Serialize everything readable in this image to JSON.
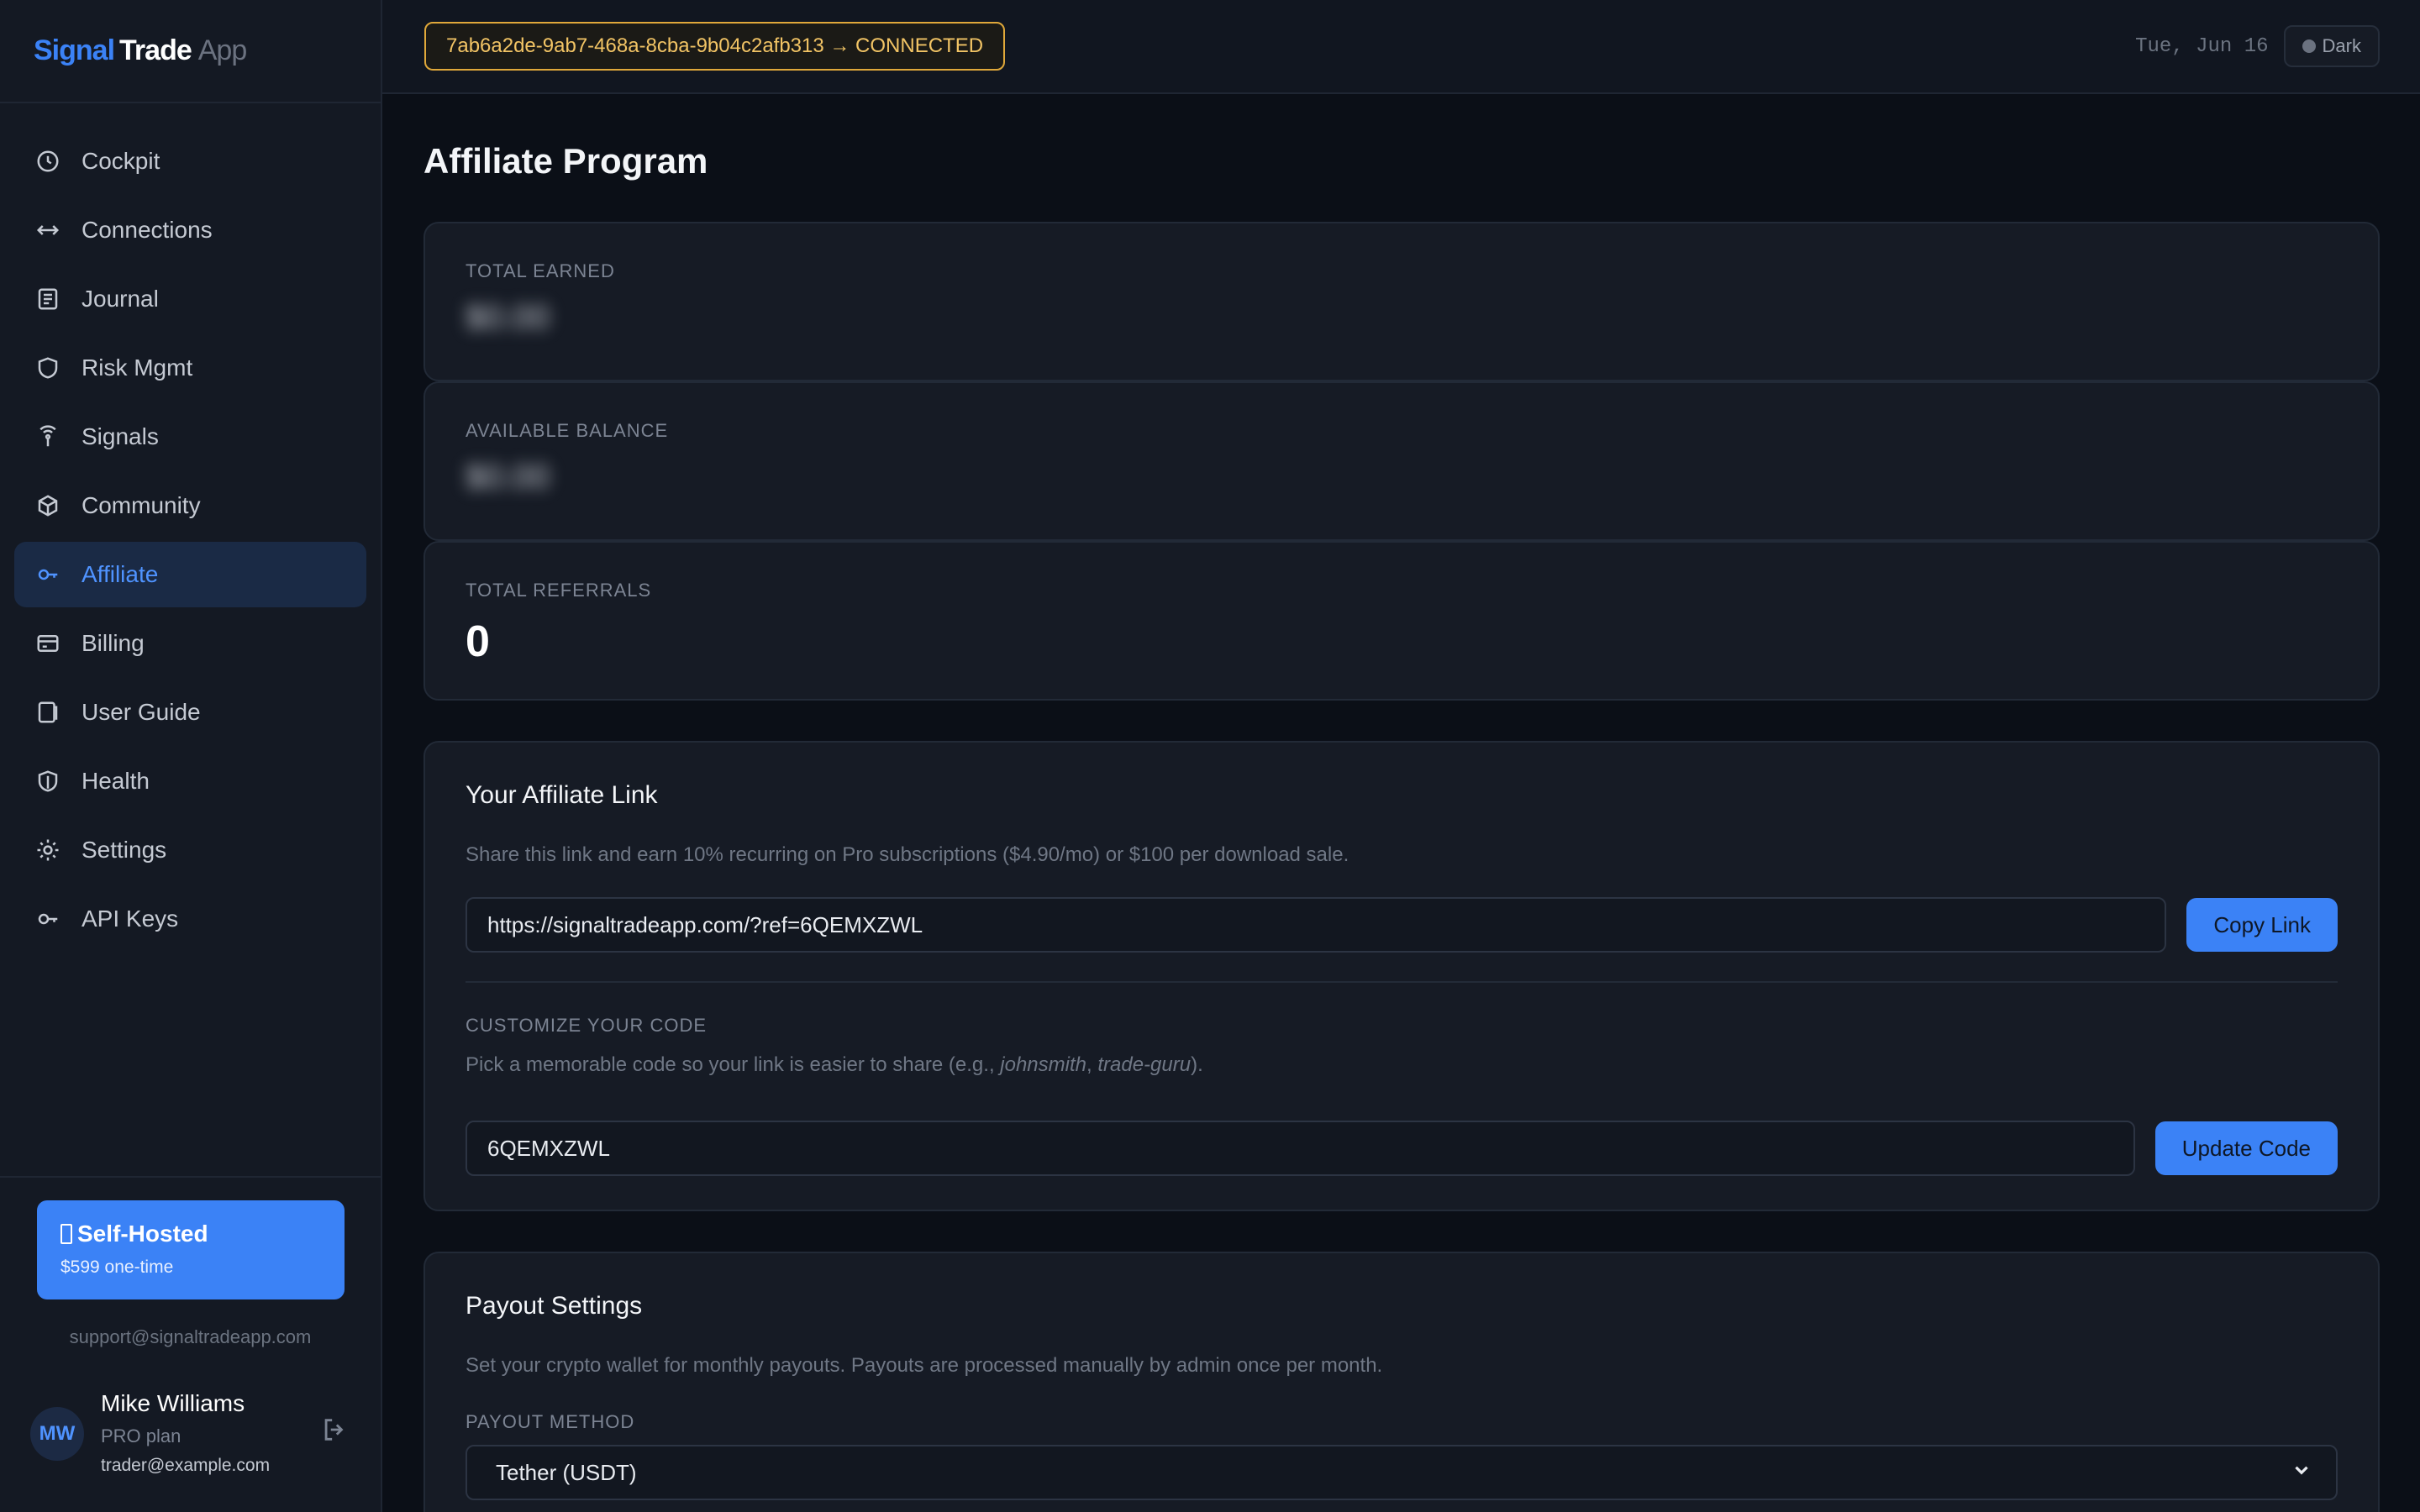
{
  "brand": {
    "part1": "Signal",
    "part2": "Trade",
    "part3": "App"
  },
  "nav": {
    "items": [
      {
        "label": "Cockpit",
        "icon": "clock-icon"
      },
      {
        "label": "Connections",
        "icon": "arrows-horizontal-icon"
      },
      {
        "label": "Journal",
        "icon": "journal-icon"
      },
      {
        "label": "Risk Mgmt",
        "icon": "shield-icon"
      },
      {
        "label": "Signals",
        "icon": "broadcast-icon"
      },
      {
        "label": "Community",
        "icon": "cube-icon"
      },
      {
        "label": "Affiliate",
        "icon": "key-icon"
      },
      {
        "label": "Billing",
        "icon": "credit-card-icon"
      },
      {
        "label": "User Guide",
        "icon": "book-icon"
      },
      {
        "label": "Health",
        "icon": "heart-shield-icon"
      },
      {
        "label": "Settings",
        "icon": "gear-icon"
      },
      {
        "label": "API Keys",
        "icon": "key-icon"
      }
    ],
    "active": "Affiliate"
  },
  "promo": {
    "title": "Self-Hosted",
    "price": "$599 one-time"
  },
  "support_email": "support@signaltradeapp.com",
  "user": {
    "initials": "MW",
    "name": "Mike Williams",
    "plan": "PRO plan",
    "email": "trader@example.com"
  },
  "topbar": {
    "connection": "7ab6a2de-9ab7-468a-8cba-9b04c2afb313 → CONNECTED",
    "date": "Tue, Jun 16",
    "theme_label": "Dark"
  },
  "page": {
    "title": "Affiliate Program",
    "stats": [
      {
        "label": "TOTAL EARNED",
        "value": "$0.00",
        "blurred": true
      },
      {
        "label": "AVAILABLE BALANCE",
        "value": "$0.00",
        "blurred": true
      },
      {
        "label": "TOTAL REFERRALS",
        "value": "0",
        "blurred": false
      }
    ],
    "link_panel": {
      "title": "Your Affiliate Link",
      "desc": "Share this link and earn 10% recurring on Pro subscriptions ($4.90/mo) or $100 per download sale.",
      "link_value": "https://signaltradeapp.com/?ref=6QEMXZWL",
      "copy_label": "Copy Link",
      "customize_label": "CUSTOMIZE YOUR CODE",
      "customize_desc_prefix": "Pick a memorable code so your link is easier to share (e.g., ",
      "customize_example_1": "johnsmith",
      "customize_example_sep": ", ",
      "customize_example_2": "trade-guru",
      "customize_desc_suffix": ").",
      "code_value": "6QEMXZWL",
      "update_label": "Update Code"
    },
    "payout_panel": {
      "title": "Payout Settings",
      "desc": "Set your crypto wallet for monthly payouts. Payouts are processed manually by admin once per month.",
      "method_label": "PAYOUT METHOD",
      "method_value": "Tether (USDT)"
    }
  }
}
